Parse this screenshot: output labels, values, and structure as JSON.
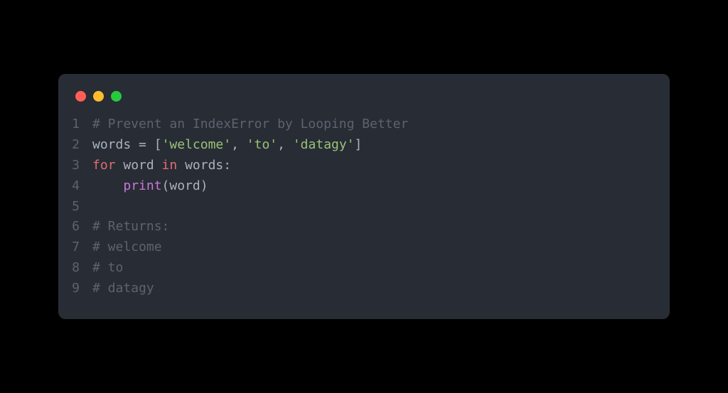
{
  "window": {
    "buttons": [
      "close",
      "minimize",
      "zoom"
    ]
  },
  "code": {
    "language": "python",
    "lines": [
      {
        "num": "1",
        "tokens": [
          {
            "cls": "tok-comment",
            "t": "# Prevent an IndexError by Looping Better"
          }
        ]
      },
      {
        "num": "2",
        "tokens": [
          {
            "cls": "tok-plain",
            "t": "words "
          },
          {
            "cls": "tok-operator",
            "t": "="
          },
          {
            "cls": "tok-plain",
            "t": " "
          },
          {
            "cls": "tok-punct",
            "t": "["
          },
          {
            "cls": "tok-string",
            "t": "'welcome'"
          },
          {
            "cls": "tok-punct",
            "t": ", "
          },
          {
            "cls": "tok-string",
            "t": "'to'"
          },
          {
            "cls": "tok-punct",
            "t": ", "
          },
          {
            "cls": "tok-string",
            "t": "'datagy'"
          },
          {
            "cls": "tok-punct",
            "t": "]"
          }
        ]
      },
      {
        "num": "3",
        "tokens": [
          {
            "cls": "tok-keyword",
            "t": "for"
          },
          {
            "cls": "tok-plain",
            "t": " word "
          },
          {
            "cls": "tok-keyword",
            "t": "in"
          },
          {
            "cls": "tok-plain",
            "t": " words"
          },
          {
            "cls": "tok-punct",
            "t": ":"
          }
        ]
      },
      {
        "num": "4",
        "tokens": [
          {
            "cls": "tok-plain",
            "t": "    "
          },
          {
            "cls": "tok-func",
            "t": "print"
          },
          {
            "cls": "tok-punct",
            "t": "("
          },
          {
            "cls": "tok-plain",
            "t": "word"
          },
          {
            "cls": "tok-punct",
            "t": ")"
          }
        ]
      },
      {
        "num": "5",
        "tokens": [
          {
            "cls": "tok-plain",
            "t": ""
          }
        ]
      },
      {
        "num": "6",
        "tokens": [
          {
            "cls": "tok-comment",
            "t": "# Returns:"
          }
        ]
      },
      {
        "num": "7",
        "tokens": [
          {
            "cls": "tok-comment",
            "t": "# welcome"
          }
        ]
      },
      {
        "num": "8",
        "tokens": [
          {
            "cls": "tok-comment",
            "t": "# to"
          }
        ]
      },
      {
        "num": "9",
        "tokens": [
          {
            "cls": "tok-comment",
            "t": "# datagy"
          }
        ]
      }
    ]
  }
}
